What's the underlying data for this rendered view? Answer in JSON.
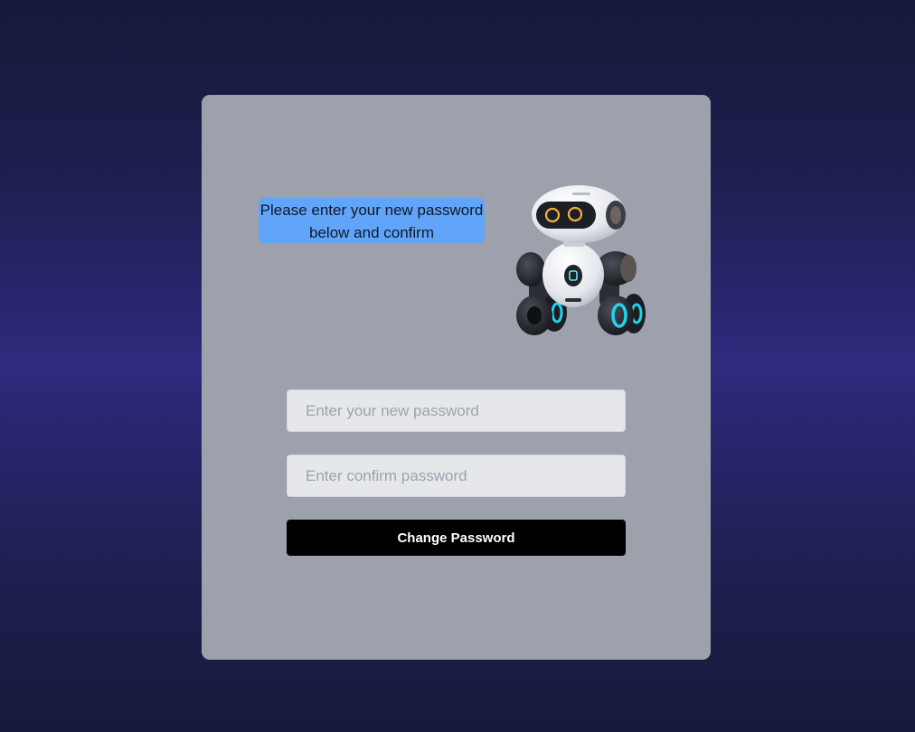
{
  "card": {
    "message": "Please enter your new password below and confirm",
    "robot_image": "robot-mascot-image"
  },
  "form": {
    "new_password": {
      "value": "",
      "placeholder": "Enter your new password"
    },
    "confirm_password": {
      "value": "",
      "placeholder": "Enter confirm password"
    },
    "submit_label": "Change Password"
  },
  "colors": {
    "background_mid": "#2f2a7e",
    "background_edge": "#171a3b",
    "card": "#9ca1ab",
    "bubble": "#60a5fa",
    "input": "#e5e7eb",
    "button": "#000000",
    "robot_accent": "#22d3ee"
  }
}
